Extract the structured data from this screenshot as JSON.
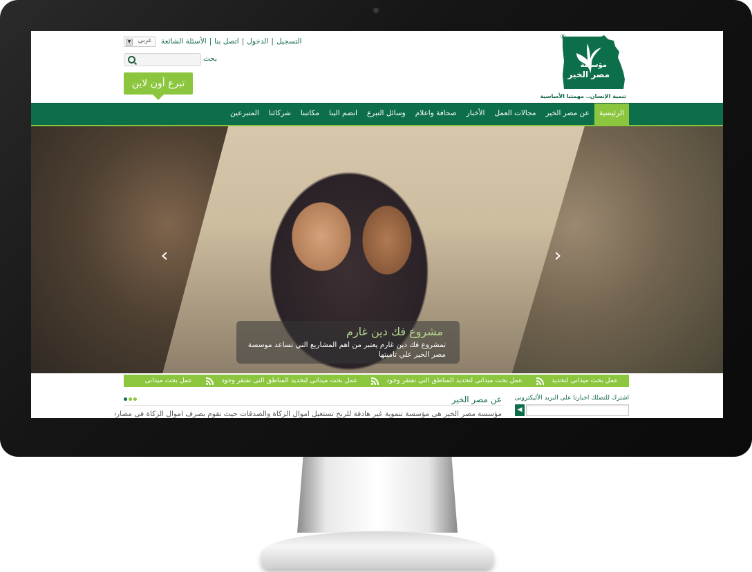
{
  "colors": {
    "brand_green": "#0d6e4a",
    "accent_green": "#8cc63f",
    "text_green": "#146a47"
  },
  "logo": {
    "reg_mark": "®",
    "word_1": "مؤسسة",
    "word_2": "مصر الخير",
    "tagline": "تنمية الإنسان.. مهمتنا الأساسية"
  },
  "header": {
    "links": [
      "التسجيل",
      "الدخول",
      "اتصل بنا",
      "الأسئلة الشائعة"
    ],
    "lang_select": {
      "value": "عربي"
    },
    "search": {
      "label": "بحث",
      "placeholder": "",
      "icon": "search-icon"
    },
    "donate_button": "تبرع أون لاين"
  },
  "nav": {
    "items": [
      "الرئيسية",
      "عن مصر الخير",
      "مجالات العمل",
      "الأخبار",
      "صحافة واعلام",
      "وسائل التبرع",
      "انضم الينا",
      "مكاتبنا",
      "شركائنا",
      "المتبرعين"
    ],
    "active_index": 0
  },
  "slider": {
    "prev_icon": "chevron-left-icon",
    "next_icon": "chevron-right-icon",
    "caption_title": "مشروع فك دين غارم",
    "caption_text": "تمشروع فك دين غارم يعتبر من اهم المشاريع التي تساعد موسسة مصر الخير علي تاميتها"
  },
  "ticker": {
    "items": [
      "عمل بحث ميدانى لتحديد",
      "عمل بحث ميدانى لتحديد المناطق التى تفتقر وجود",
      "عمل بحث ميدانى لتحديد المناطق التى تفتقر وجود",
      "عمل بحث ميدانى"
    ],
    "icon": "rss-icon"
  },
  "about": {
    "title": "عن مصر الخير",
    "text": "مؤسسة مصر الخير هى مؤسسة تنموية غير هادفة للربح تستغيل اموال الزكاة والصدقات حيث تقوم بصرف اموال الزكاة فى مصارفها",
    "dot_colors": [
      "#0d6e4a",
      "#8cc63f",
      "#8cc63f"
    ]
  },
  "newsletter": {
    "label": "اشترك للتصلك اخبارنا على البريد الأليكترونى",
    "placeholder": "",
    "button_icon": "arrow-left-icon"
  }
}
